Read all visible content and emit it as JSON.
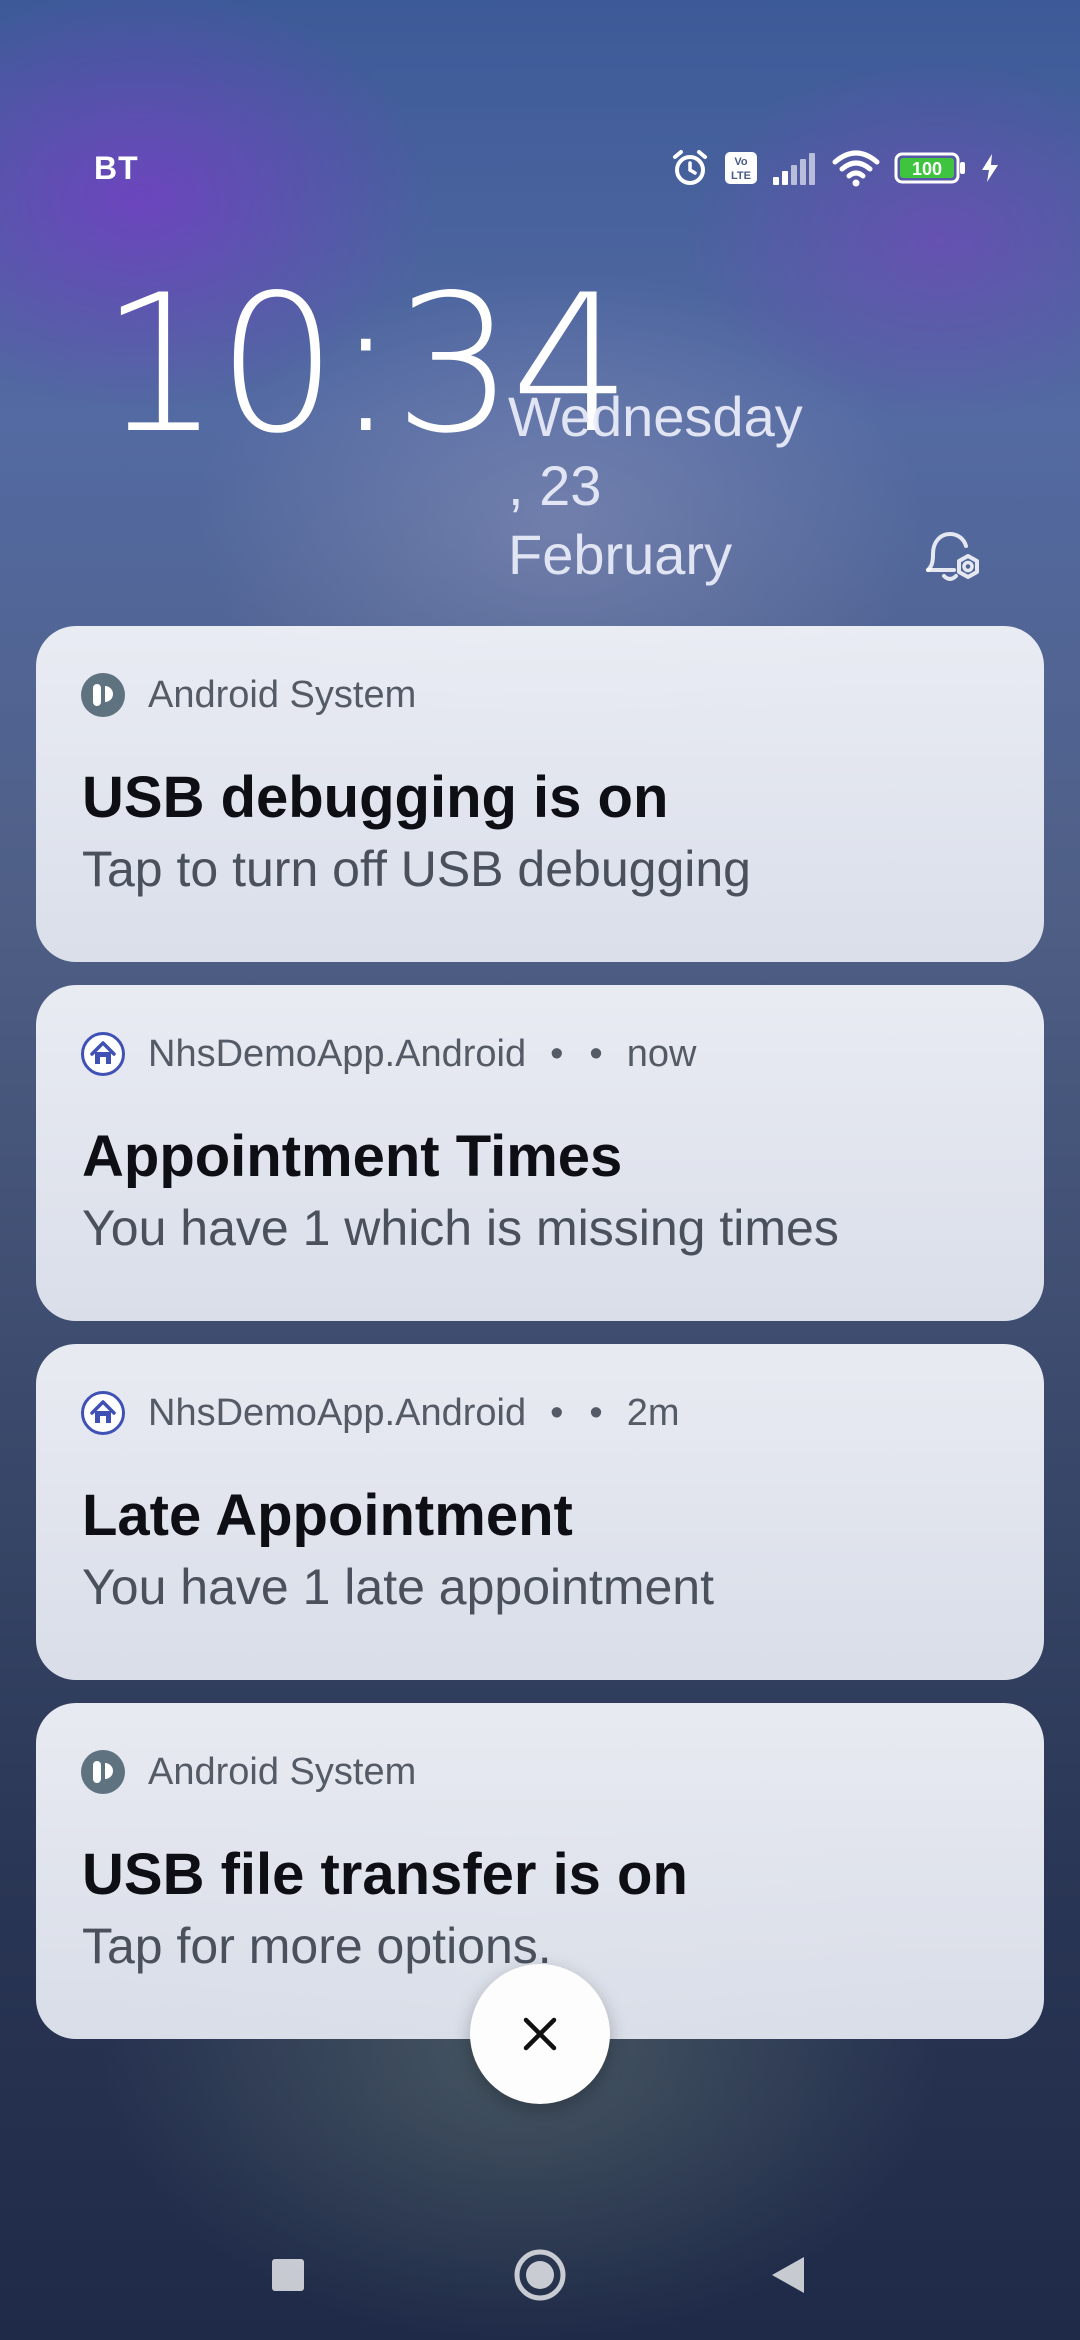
{
  "status_bar": {
    "carrier": "BT",
    "battery_level": "100",
    "icons": [
      "alarm-icon",
      "volte-icon",
      "signal-icon",
      "wifi-icon",
      "battery-icon",
      "charging-icon"
    ]
  },
  "lockscreen": {
    "time": "10:34",
    "date_line1": "Wednesday",
    "date_line2": ", 23",
    "date_line3": "February"
  },
  "notifications": [
    {
      "app": "Android System",
      "time": "",
      "title": "USB debugging is on",
      "body": "Tap to turn off USB debugging",
      "icon": "android-system-icon"
    },
    {
      "app": "NhsDemoApp.Android",
      "time": "now",
      "title": "Appointment Times",
      "body": "You have 1 which is missing times",
      "icon": "home-app-icon"
    },
    {
      "app": "NhsDemoApp.Android",
      "time": "2m",
      "title": "Late Appointment",
      "body": "You have 1 late appointment",
      "icon": "home-app-icon"
    },
    {
      "app": "Android System",
      "time": "",
      "title": "USB file transfer is on",
      "body": "Tap for more options.",
      "icon": "android-system-icon"
    }
  ],
  "navigation": {
    "buttons": [
      "recents-button",
      "home-button",
      "back-button"
    ]
  },
  "colors": {
    "card_background": "#eceef4",
    "title_text": "#0d0f14",
    "body_text": "#4a505c",
    "app_icon_blue": "#3f51b5",
    "system_icon": "#5f7280",
    "battery_green": "#3ec43e"
  }
}
